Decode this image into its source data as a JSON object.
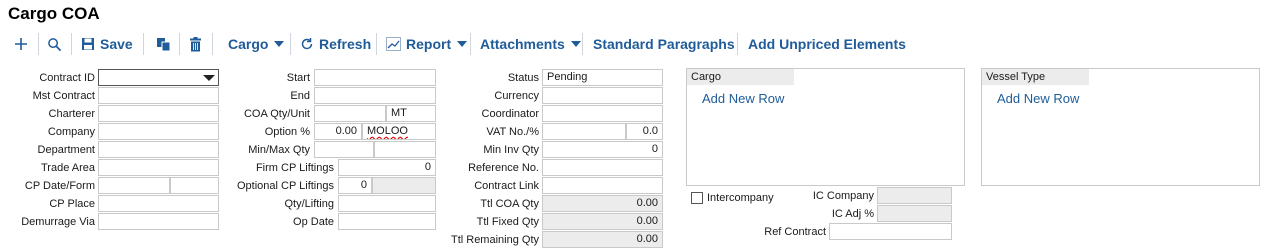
{
  "page": {
    "title": "Cargo COA"
  },
  "toolbar": {
    "save": "Save",
    "cargo": "Cargo",
    "refresh": "Refresh",
    "report": "Report",
    "attachments": "Attachments",
    "standard_paragraphs": "Standard Paragraphs",
    "add_unpriced": "Add Unpriced Elements"
  },
  "col1": {
    "contract_id": "Contract ID",
    "mst_contract": "Mst Contract",
    "charterer": "Charterer",
    "company": "Company",
    "department": "Department",
    "trade_area": "Trade Area",
    "cp_date_form": "CP Date/Form",
    "cp_place": "CP Place",
    "demurrage_via": "Demurrage Via"
  },
  "col2": {
    "start": "Start",
    "end": "End",
    "coa_qty_unit": "COA Qty/Unit",
    "coa_unit_value": "MT",
    "option_pct": "Option %",
    "option_value": "0.00",
    "option_code": "MOLOO",
    "min_max_qty": "Min/Max Qty",
    "firm_cp_liftings": "Firm CP Liftings",
    "firm_cp_value": "0",
    "optional_cp_liftings": "Optional CP Liftings",
    "optional_cp_value": "0",
    "qty_lifting": "Qty/Lifting",
    "op_date": "Op Date"
  },
  "col3": {
    "status": "Status",
    "status_value": "Pending",
    "currency": "Currency",
    "coordinator": "Coordinator",
    "vat_no_pct": "VAT No./%",
    "vat_value": "0.0",
    "min_inv_qty": "Min Inv Qty",
    "min_inv_value": "0",
    "reference_no": "Reference No.",
    "contract_link": "Contract Link",
    "ttl_coa_qty": "Ttl COA Qty",
    "ttl_coa_value": "0.00",
    "ttl_fixed_qty": "Ttl Fixed Qty",
    "ttl_fixed_value": "0.00",
    "ttl_remaining_qty": "Ttl Remaining Qty",
    "ttl_remaining_value": "0.00"
  },
  "cargo_panel": {
    "header": "Cargo",
    "add_row": "Add New Row"
  },
  "vessel_panel": {
    "header": "Vessel Type",
    "add_row": "Add New Row"
  },
  "intercompany": {
    "label": "Intercompany",
    "ic_company": "IC Company",
    "ic_adj_pct": "IC Adj %",
    "ref_contract": "Ref Contract"
  },
  "icons": [
    "plus-icon",
    "search-icon",
    "save-icon",
    "copy-icon",
    "trash-icon",
    "refresh-icon",
    "chart-icon"
  ]
}
